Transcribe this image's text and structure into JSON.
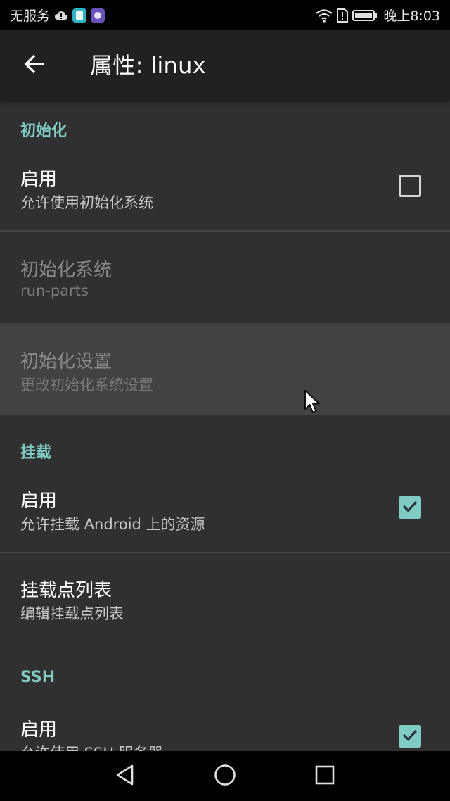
{
  "status_bar": {
    "carrier": "无服务",
    "time": "晚上8:03",
    "icons": [
      "cloud-icon",
      "book-app-icon",
      "app-icon",
      "wifi-icon",
      "sim-alert-icon",
      "battery-icon"
    ]
  },
  "app_bar": {
    "back_icon": "arrow-left-icon",
    "title": "属性: linux"
  },
  "sections": {
    "init": {
      "header": "初始化",
      "enable": {
        "title": "启用",
        "summary": "允许使用初始化系统",
        "checked": false
      },
      "system": {
        "title": "初始化系统",
        "summary": "run-parts",
        "enabled": false
      },
      "settings": {
        "title": "初始化设置",
        "summary": "更改初始化系统设置",
        "enabled": false
      }
    },
    "mount": {
      "header": "挂载",
      "enable": {
        "title": "启用",
        "summary": "允许挂载 Android 上的资源",
        "checked": true
      },
      "points": {
        "title": "挂载点列表",
        "summary": "编辑挂载点列表"
      }
    },
    "ssh": {
      "header": "SSH",
      "enable": {
        "title": "启用",
        "summary": "允许使用 SSH 服务器",
        "checked": true
      }
    }
  },
  "nav_bar": {
    "icons": [
      "back-triangle-icon",
      "home-circle-icon",
      "recents-square-icon"
    ]
  },
  "colors": {
    "accent": "#80cbc4",
    "background": "#303030",
    "app_bar": "#212121",
    "highlight": "#424242"
  }
}
